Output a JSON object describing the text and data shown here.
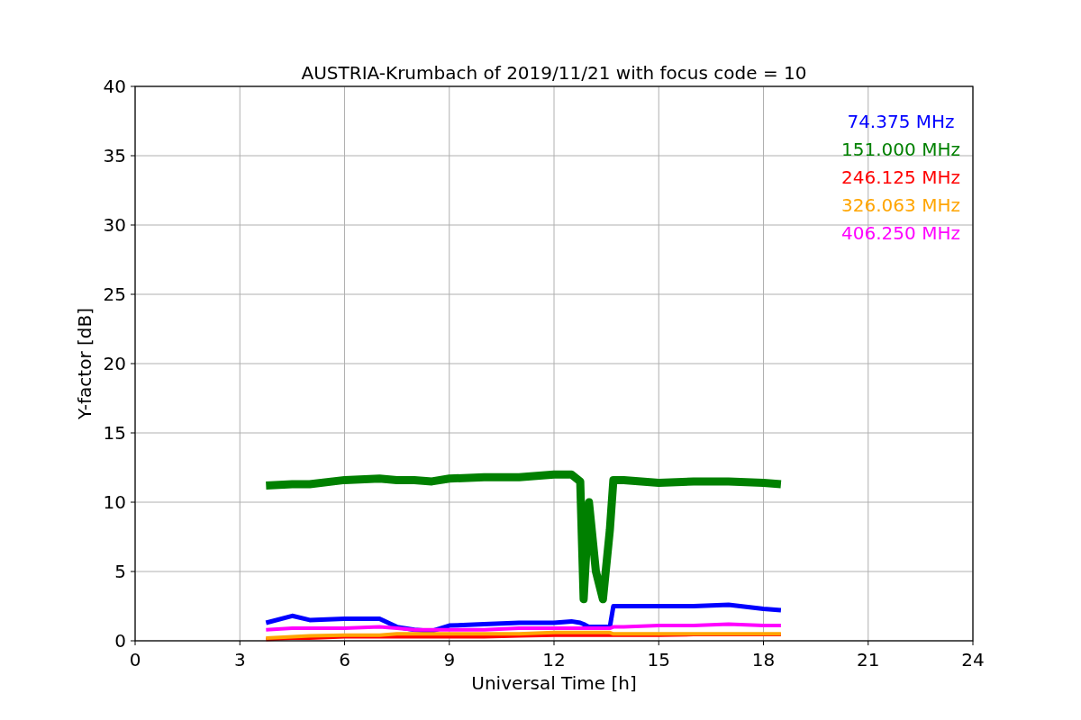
{
  "figure": {
    "chart_data": {
      "type": "line",
      "title": "AUSTRIA-Krumbach of 2019/11/21 with focus code = 10",
      "xlabel": "Universal Time [h]",
      "ylabel": "Y-factor [dB]",
      "x": [
        3.75,
        4.5,
        5,
        6,
        7,
        7.5,
        8,
        8.5,
        9,
        10,
        11,
        12,
        12.5,
        12.75,
        12.85,
        13,
        13.2,
        13.4,
        13.6,
        13.7,
        14,
        15,
        16,
        17,
        18,
        18.5
      ],
      "series": [
        {
          "name": "74.375 MHz",
          "color": "#0000ff",
          "values": [
            1.3,
            1.8,
            1.5,
            1.6,
            1.6,
            1.0,
            0.8,
            0.7,
            1.1,
            1.2,
            1.3,
            1.3,
            1.4,
            1.3,
            1.2,
            1.0,
            1.0,
            1.0,
            1.0,
            2.5,
            2.5,
            2.5,
            2.5,
            2.6,
            2.3,
            2.2
          ]
        },
        {
          "name": "151.000 MHz",
          "color": "#008000",
          "values": [
            11.2,
            11.3,
            11.3,
            11.6,
            11.7,
            11.6,
            11.6,
            11.5,
            11.7,
            11.8,
            11.8,
            12.0,
            12.0,
            11.5,
            3,
            10,
            5,
            3,
            8,
            11.6,
            11.6,
            11.4,
            11.5,
            11.5,
            11.4,
            11.3
          ]
        },
        {
          "name": "246.125 MHz",
          "color": "#ff0000",
          "values": [
            0.1,
            0.2,
            0.2,
            0.3,
            0.3,
            0.3,
            0.3,
            0.3,
            0.3,
            0.3,
            0.35,
            0.4,
            0.4,
            0.4,
            0.4,
            0.4,
            0.4,
            0.4,
            0.4,
            0.4,
            0.4,
            0.4,
            0.45,
            0.45,
            0.45,
            0.45
          ]
        },
        {
          "name": "326.063 MHz",
          "color": "#ffa500",
          "values": [
            0.2,
            0.3,
            0.35,
            0.4,
            0.4,
            0.5,
            0.5,
            0.5,
            0.5,
            0.5,
            0.5,
            0.6,
            0.6,
            0.6,
            0.6,
            0.6,
            0.6,
            0.6,
            0.6,
            0.5,
            0.5,
            0.5,
            0.5,
            0.5,
            0.5,
            0.5
          ]
        },
        {
          "name": "406.250 MHz",
          "color": "#ff00ff",
          "values": [
            0.8,
            0.9,
            0.9,
            0.9,
            1.0,
            0.9,
            0.8,
            0.8,
            0.8,
            0.8,
            0.9,
            0.9,
            0.9,
            0.9,
            0.9,
            0.9,
            0.9,
            0.9,
            0.9,
            1.0,
            1.0,
            1.1,
            1.1,
            1.2,
            1.1,
            1.1
          ]
        }
      ],
      "grid": true,
      "xlim": [
        0,
        24
      ],
      "ylim": [
        0,
        40
      ],
      "xticks": [
        0,
        3,
        6,
        9,
        12,
        15,
        18,
        21,
        24
      ],
      "yticks": [
        0,
        5,
        10,
        15,
        20,
        25,
        30,
        35,
        40
      ]
    }
  }
}
